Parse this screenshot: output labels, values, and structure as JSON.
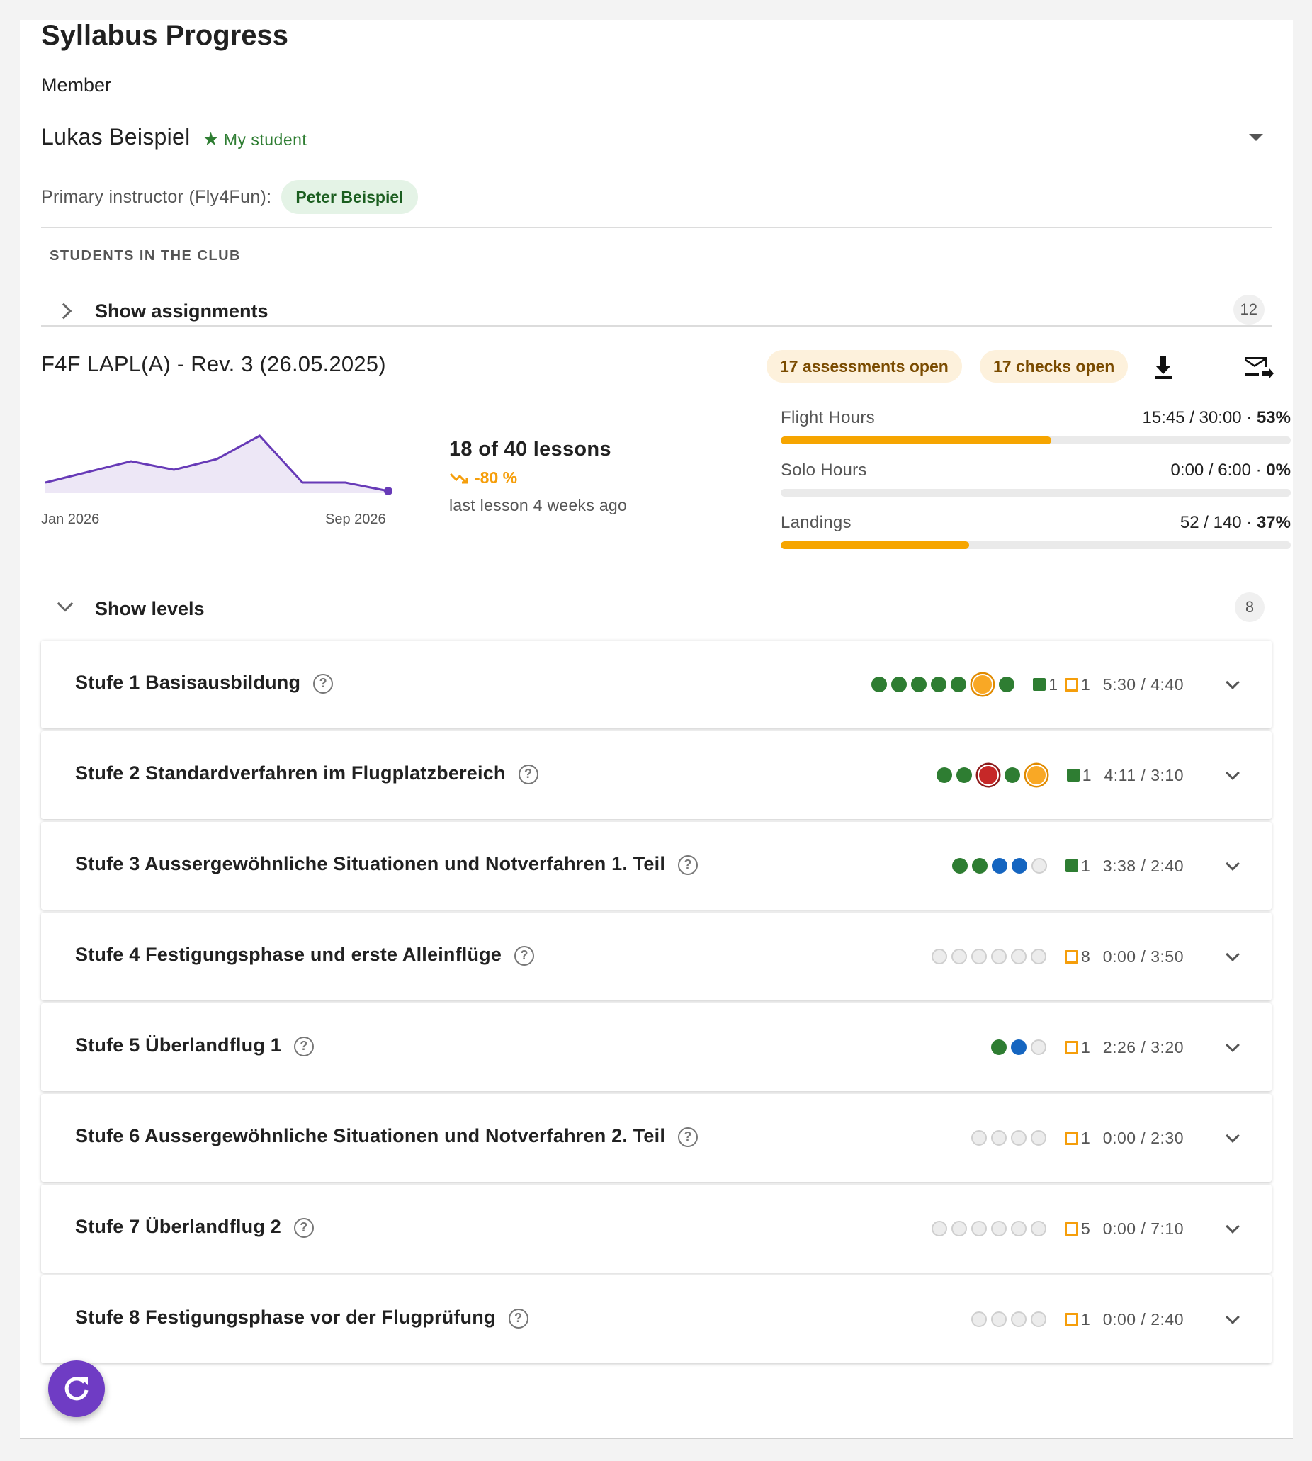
{
  "title": "Syllabus Progress",
  "member": {
    "label": "Member",
    "name": "Lukas Beispiel",
    "tag": "My student"
  },
  "instructor": {
    "label": "Primary instructor (Fly4Fun):",
    "name": "Peter Beispiel"
  },
  "students_section": {
    "label": "STUDENTS IN THE CLUB",
    "toggle_label": "Show assignments",
    "count": "12"
  },
  "syllabus": {
    "title": "F4F LAPL(A) - Rev. 3 (26.05.2025)",
    "assessments_chip": "17 assessments open",
    "checks_chip": "17 checks open",
    "download_icon": "download-icon",
    "email_icon": "forward-email-icon"
  },
  "sparkline": {
    "start_label": "Jan 2026",
    "end_label": "Sep 2026",
    "color": "#673ab7",
    "values": [
      0.25,
      0.5,
      0.75,
      0.55,
      0.8,
      1.35,
      0.25,
      0.25,
      0.05
    ]
  },
  "lessons": {
    "summary": "18 of 40 lessons",
    "trend": "-80 %",
    "last": "last lesson 4 weeks ago"
  },
  "metrics": [
    {
      "label": "Flight Hours",
      "value": "15:45 / 30:00",
      "pct": "53%",
      "fraction": 0.53
    },
    {
      "label": "Solo Hours",
      "value": "0:00 / 6:00",
      "pct": "0%",
      "fraction": 0.0
    },
    {
      "label": "Landings",
      "value": "52 / 140",
      "pct": "37%",
      "fraction": 0.37
    }
  ],
  "levels_section": {
    "toggle_label": "Show levels",
    "count": "8"
  },
  "levels": [
    {
      "name": "Stufe 1 Basisausbildung",
      "dots": [
        "green",
        "green",
        "green",
        "green",
        "green",
        "orange-ring",
        "green"
      ],
      "done": "1",
      "open": "1",
      "time": "5:30 / 4:40"
    },
    {
      "name": "Stufe 2 Standardverfahren im Flugplatzbereich",
      "dots": [
        "green",
        "green",
        "red-ring",
        "green",
        "orange-ring"
      ],
      "done": "1",
      "open": null,
      "time": "4:11 / 3:10"
    },
    {
      "name": "Stufe 3 Aussergewöhnliche Situationen und Notverfahren 1. Teil",
      "dots": [
        "green",
        "green",
        "blue",
        "blue",
        "empty"
      ],
      "done": "1",
      "open": null,
      "time": "3:38 / 2:40"
    },
    {
      "name": "Stufe 4 Festigungsphase und erste Alleinflüge",
      "dots": [
        "empty",
        "empty",
        "empty",
        "empty",
        "empty",
        "empty"
      ],
      "done": null,
      "open": "8",
      "time": "0:00 / 3:50"
    },
    {
      "name": "Stufe 5 Überlandflug 1",
      "dots": [
        "green",
        "blue",
        "empty"
      ],
      "done": null,
      "open": "1",
      "time": "2:26 / 3:20"
    },
    {
      "name": "Stufe 6 Aussergewöhnliche Situationen und Notverfahren 2. Teil",
      "dots": [
        "empty",
        "empty",
        "empty",
        "empty"
      ],
      "done": null,
      "open": "1",
      "time": "0:00 / 2:30"
    },
    {
      "name": "Stufe 7 Überlandflug 2",
      "dots": [
        "empty",
        "empty",
        "empty",
        "empty",
        "empty",
        "empty"
      ],
      "done": null,
      "open": "5",
      "time": "0:00 / 7:10"
    },
    {
      "name": "Stufe 8 Festigungsphase vor der Flugprüfung",
      "dots": [
        "empty",
        "empty",
        "empty",
        "empty"
      ],
      "done": null,
      "open": "1",
      "time": "0:00 / 2:40"
    }
  ],
  "fab_icon": "refresh-icon"
}
